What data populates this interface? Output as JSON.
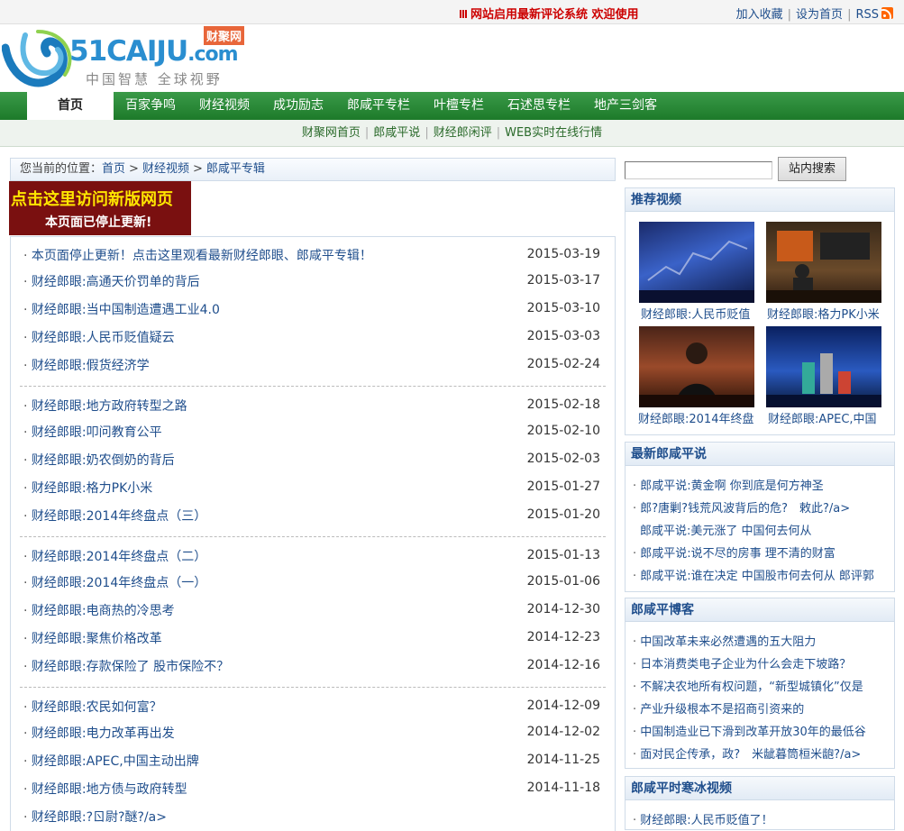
{
  "topbar": {
    "notice": "网站启用最新评论系统 欢迎使用",
    "links": [
      "加入收藏",
      "设为首页",
      "RSS"
    ]
  },
  "logo": {
    "brand": "51CAIJU",
    "brand_com": ".com",
    "badge": "财聚网",
    "slogan": "中国智慧 全球视野"
  },
  "nav": [
    "首页",
    "百家争鸣",
    "财经视频",
    "成功励志",
    "郎咸平专栏",
    "叶檀专栏",
    "石述思专栏",
    "地产三剑客"
  ],
  "subnav": [
    "财聚网首页",
    "郎咸平说",
    "财经郎闲评",
    "WEB实时在线行情"
  ],
  "breadcrumb": {
    "prefix": "您当前的位置：",
    "items": [
      "首页",
      "财经视频",
      "郎咸平专辑"
    ]
  },
  "banner": {
    "line1": "点击这里访问新版网页",
    "line2": "本页面已停止更新!"
  },
  "articles": [
    [
      {
        "title": "本页面停止更新！点击这里观看最新财经郎眼、郎咸平专辑！",
        "date": "2015-03-19"
      },
      {
        "title": "财经郎眼:高通天价罚单的背后",
        "date": "2015-03-17"
      },
      {
        "title": "财经郎眼:当中国制造遭遇工业4.0",
        "date": "2015-03-10"
      },
      {
        "title": "财经郎眼:人民币贬值疑云",
        "date": "2015-03-03"
      },
      {
        "title": "财经郎眼:假货经济学",
        "date": "2015-02-24"
      }
    ],
    [
      {
        "title": "财经郎眼:地方政府转型之路",
        "date": "2015-02-18"
      },
      {
        "title": "财经郎眼:叩问教育公平",
        "date": "2015-02-10"
      },
      {
        "title": "财经郎眼:奶农倒奶的背后",
        "date": "2015-02-03"
      },
      {
        "title": "财经郎眼:格力PK小米",
        "date": "2015-01-27"
      },
      {
        "title": "财经郎眼:2014年终盘点（三）",
        "date": "2015-01-20"
      }
    ],
    [
      {
        "title": "财经郎眼:2014年终盘点（二）",
        "date": "2015-01-13"
      },
      {
        "title": "财经郎眼:2014年终盘点（一）",
        "date": "2015-01-06"
      },
      {
        "title": "财经郎眼:电商热的冷思考",
        "date": "2014-12-30"
      },
      {
        "title": "财经郎眼:聚焦价格改革",
        "date": "2014-12-23"
      },
      {
        "title": "财经郎眼:存款保险了 股市保险不？",
        "date": "2014-12-16"
      }
    ],
    [
      {
        "title": "财经郎眼:农民如何富？",
        "date": "2014-12-09"
      },
      {
        "title": "财经郎眼:电力改革再出发",
        "date": "2014-12-02"
      },
      {
        "title": "财经郎眼:APEC,中国主动出牌",
        "date": "2014-11-25"
      },
      {
        "title": "财经郎眼:地方债与政府转型",
        "date": "2014-11-18"
      },
      {
        "title": "财经郎眼:?ㄖ尉?醚?/a>",
        "date": ""
      }
    ]
  ],
  "search": {
    "button": "站内搜索"
  },
  "sidebar": {
    "videos_title": "推荐视频",
    "videos": [
      "财经郎眼:人民币贬值",
      "财经郎眼:格力PK小米",
      "财经郎眼:2014年终盘",
      "财经郎眼:APEC,中国"
    ],
    "shuo_title": "最新郎咸平说",
    "shuo": [
      "郎咸平说:黄金啊 你到底是何方神圣",
      "郎?唐剿?钱荒风波背后的危?　敕此?/a>",
      "郎咸平说:美元涨了 中国何去何从",
      "郎咸平说:说不尽的房事 理不清的财富",
      "郎咸平说:谁在决定 中国股市何去何从 郎评郭"
    ],
    "blog_title": "郎咸平博客",
    "blog": [
      "中国改革未来必然遭遇的五大阻力",
      "日本消费类电子企业为什么会走下坡路？",
      "不解决农地所有权问题，“新型城镇化”仅是",
      "产业升级根本不是招商引资来的",
      "中国制造业已下滑到改革开放30年的最低谷",
      "面对民企传承，政?　米龇暮筒桓米龅?/a>"
    ],
    "hanbing_title": "郎咸平时寒冰视频",
    "hanbing": [
      "财经郎眼:人民币贬值了！"
    ]
  }
}
